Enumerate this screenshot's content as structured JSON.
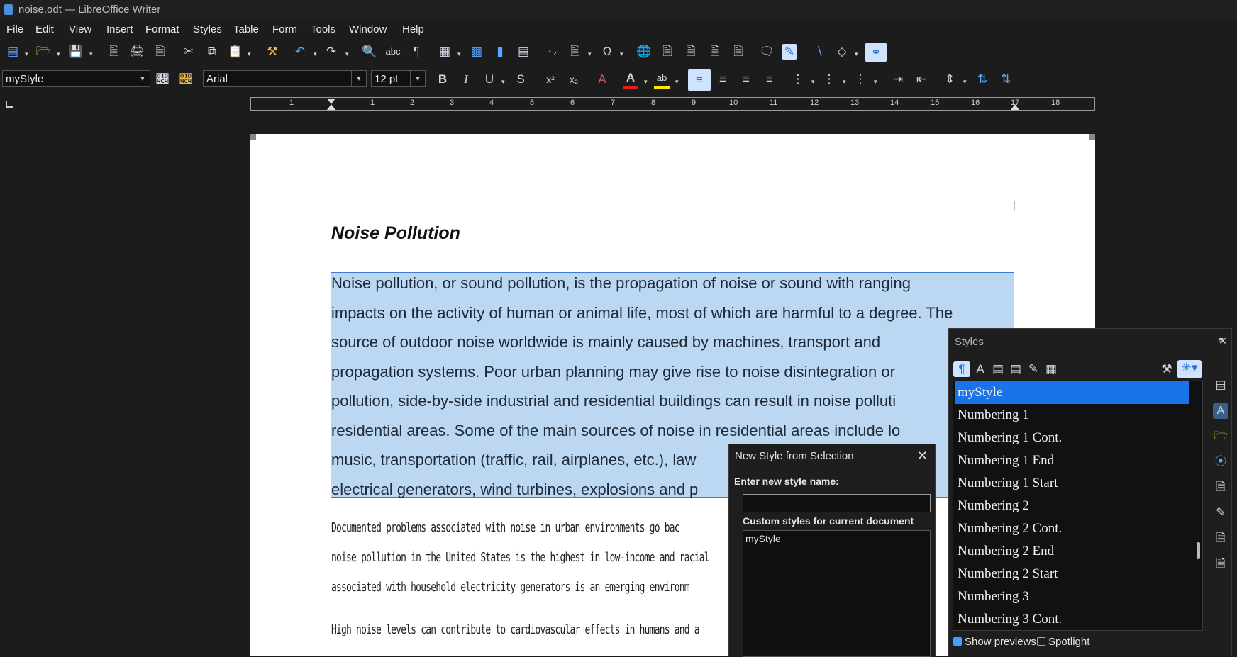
{
  "window": {
    "title": "noise.odt — LibreOffice Writer"
  },
  "menu": [
    "File",
    "Edit",
    "View",
    "Insert",
    "Format",
    "Styles",
    "Table",
    "Form",
    "Tools",
    "Window",
    "Help"
  ],
  "formatting": {
    "paragraph_style": "myStyle",
    "font_name": "Arial",
    "font_size": "12 pt"
  },
  "ruler": {
    "numbers": [
      "1",
      "1",
      "2",
      "3",
      "4",
      "5",
      "6",
      "7",
      "8",
      "9",
      "10",
      "11",
      "12",
      "13",
      "14",
      "15",
      "16",
      "17",
      "18"
    ]
  },
  "document": {
    "heading": "Noise Pollution",
    "selected_paragraph_lines": [
      "Noise pollution, or sound pollution, is the propagation of noise or sound with ranging",
      "impacts on the activity of human or animal life, most of which are harmful to a degree. The",
      "source of outdoor noise worldwide is mainly caused by machines, transport and",
      "propagation systems. Poor urban planning may give rise to noise disintegration or",
      "pollution, side-by-side industrial and residential buildings can result in noise polluti",
      "residential areas. Some of the main sources of noise in residential areas include lo",
      "music, transportation (traffic, rail, airplanes, etc.), law",
      "electrical generators, wind turbines, explosions and p"
    ],
    "para2_lines": [
      "Documented problems associated with noise in urban environments go bac",
      "noise pollution in the United States is the highest in low-income and racial",
      "associated with household electricity generators is an emerging environm"
    ],
    "para3_line": "High noise levels can contribute to cardiovascular effects in humans and a"
  },
  "dialog": {
    "title": "New Style from Selection",
    "name_label": "Enter new style name:",
    "name_value": "",
    "custom_label": "Custom styles for current document",
    "custom_styles": [
      "myStyle"
    ]
  },
  "styles_panel": {
    "title": "Styles",
    "items": [
      "myStyle",
      "Numbering 1",
      "Numbering 1 Cont.",
      "Numbering 1 End",
      "Numbering 1 Start",
      "Numbering 2",
      "Numbering 2 Cont.",
      "Numbering 2 End",
      "Numbering 2 Start",
      "Numbering 3",
      "Numbering 3 Cont."
    ],
    "selected": "myStyle",
    "show_previews_label": "Show previews",
    "show_previews_checked": true,
    "spotlight_label": "Spotlight",
    "spotlight_checked": false
  },
  "colors": {
    "selection": "#bcd7f2",
    "accent": "#1a73e8",
    "font_color_bar": "#e0201b",
    "highlight_bar": "#ffe600"
  }
}
